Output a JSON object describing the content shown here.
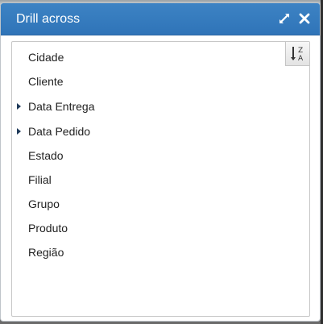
{
  "dialog": {
    "title": "Drill across"
  },
  "toolbar": {
    "maximize_icon": "expand-arrows-icon",
    "close_icon": "close-icon",
    "sort_icon": "sort-desc-z-a-icon",
    "sort_glyph_top": "Z",
    "sort_glyph_bottom": "A"
  },
  "list": {
    "items": [
      {
        "label": "Cidade",
        "expandable": false
      },
      {
        "label": "Cliente",
        "expandable": false
      },
      {
        "label": "Data Entrega",
        "expandable": true
      },
      {
        "label": "Data Pedido",
        "expandable": true
      },
      {
        "label": "Estado",
        "expandable": false
      },
      {
        "label": "Filial",
        "expandable": false
      },
      {
        "label": "Grupo",
        "expandable": false
      },
      {
        "label": "Produto",
        "expandable": false
      },
      {
        "label": "Região",
        "expandable": false
      }
    ]
  },
  "colors": {
    "titlebar": "#3579BE",
    "title_text": "#FFFFFF",
    "item_text": "#222222",
    "expander": "#1F3A5A"
  }
}
